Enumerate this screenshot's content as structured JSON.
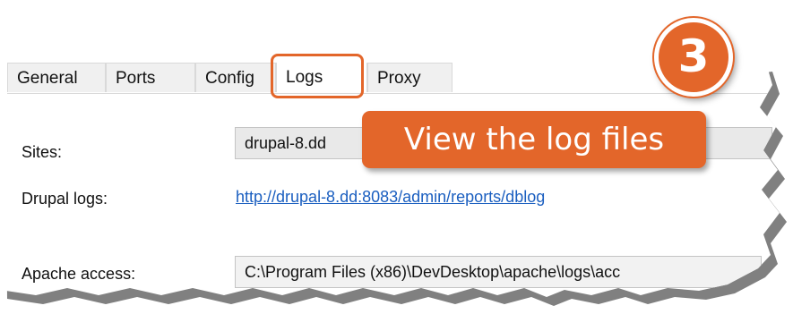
{
  "tabs": [
    {
      "label": "General"
    },
    {
      "label": "Ports"
    },
    {
      "label": "Config"
    },
    {
      "label": "Logs"
    },
    {
      "label": "Proxy"
    }
  ],
  "fields": {
    "sites_label": "Sites:",
    "sites_value": "drupal-8.dd",
    "drupal_logs_label": "Drupal logs:",
    "drupal_logs_link": "http://drupal-8.dd:8083/admin/reports/dblog",
    "apache_access_label": "Apache access:",
    "apache_access_value": "C:\\Program Files (x86)\\DevDesktop\\apache\\logs\\acc"
  },
  "annotation": {
    "callout_text": "View the log files",
    "step_number": "3",
    "accent_color": "#e3662a"
  }
}
